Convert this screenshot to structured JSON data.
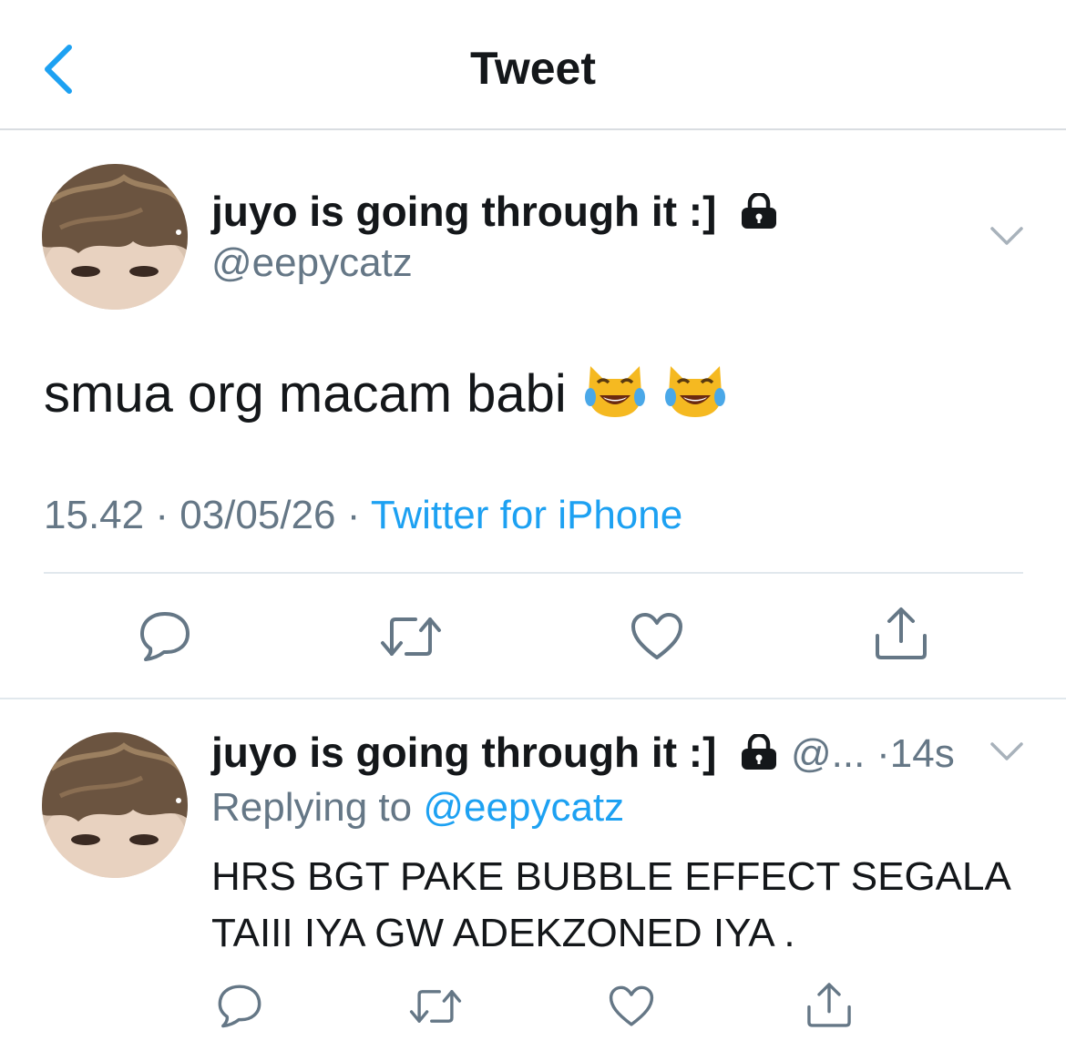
{
  "header": {
    "title": "Tweet"
  },
  "tweet": {
    "author_name": "juyo is going through it :]",
    "handle": "@eepycatz",
    "text": "smua org macam babi",
    "emojis": [
      "😹",
      "😹"
    ],
    "time": "15.42",
    "date": "03/05/26",
    "separator": "·",
    "source": "Twitter for iPhone"
  },
  "reply": {
    "author_name": "juyo is going through it :]",
    "handle_truncated": "@...",
    "separator": "·",
    "age": "14s",
    "replying_prefix": "Replying to",
    "replying_handle": "@eepycatz",
    "text": "HRS BGT PAKE BUBBLE EFFECT SEGALA\nTAIII IYA GW ADEKZONED IYA ."
  },
  "icons": {
    "back": "chevron-left-icon",
    "lock": "lock-icon",
    "menu": "chevron-down-icon",
    "reply": "reply-icon",
    "retweet": "retweet-icon",
    "like": "heart-icon",
    "share": "share-icon"
  },
  "colors": {
    "accent": "#1da1f2",
    "secondary_text": "#657786",
    "divider": "#e1e8ed",
    "icon_gray": "#657786"
  }
}
